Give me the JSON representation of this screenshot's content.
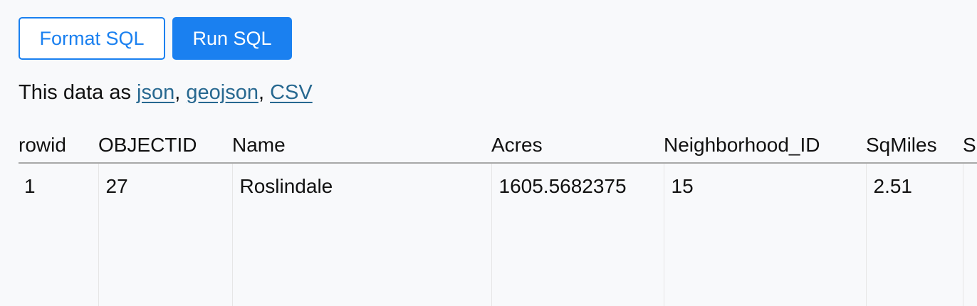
{
  "toolbar": {
    "format_label": "Format SQL",
    "run_label": "Run SQL"
  },
  "export": {
    "prefix": "This data as ",
    "json": "json",
    "sep1": ", ",
    "geojson": "geojson",
    "sep2": ", ",
    "csv": "CSV"
  },
  "table": {
    "columns": [
      "rowid",
      "OBJECTID",
      "Name",
      "Acres",
      "Neighborhood_ID",
      "SqMiles",
      "S"
    ],
    "rows": [
      [
        "1",
        "27",
        "Roslindale",
        "1605.5682375",
        "15",
        "2.51",
        ""
      ]
    ]
  }
}
